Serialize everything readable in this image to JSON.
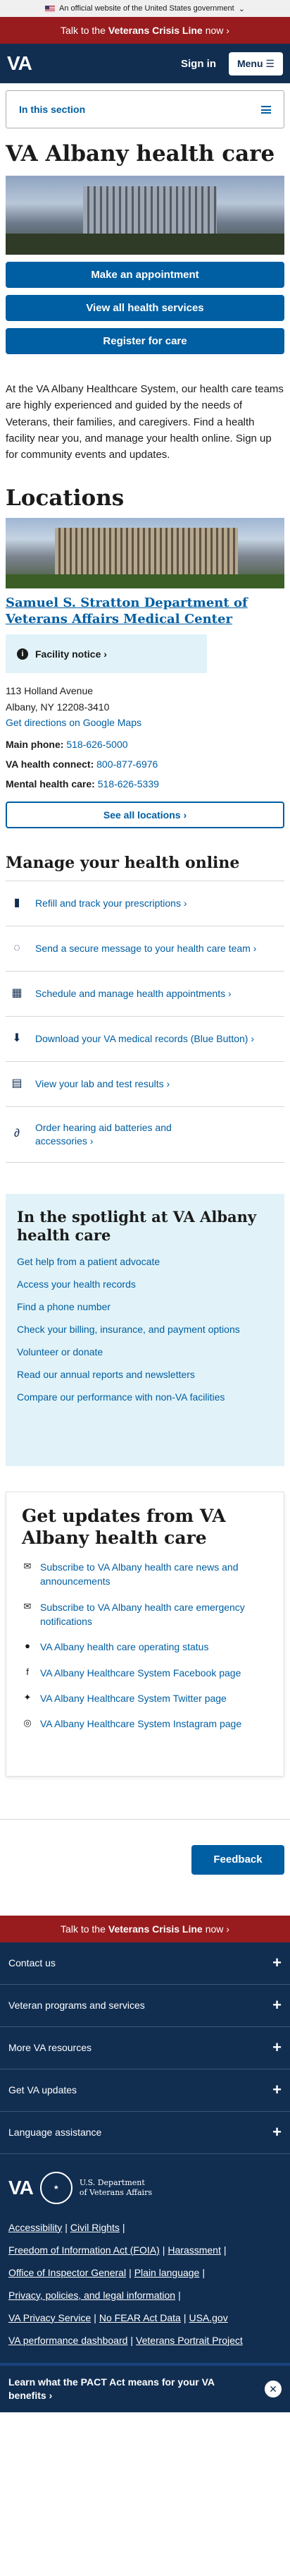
{
  "gov_banner": {
    "text": "An official website of the United States government",
    "chevron": "chevron-down-icon"
  },
  "crisis": {
    "prefix": "Talk to the",
    "strong": "Veterans Crisis Line",
    "suffix": "now ›"
  },
  "header": {
    "logo": "VA",
    "signin": "Sign in",
    "menu": "Menu"
  },
  "section_nav": {
    "label": "In this section"
  },
  "page": {
    "title": "VA Albany health care",
    "buttons": [
      "Make an appointment",
      "View all health services",
      "Register for care"
    ],
    "intro": "At the VA Albany Healthcare System, our health care teams are highly experienced and guided by the needs of Veterans, their families, and caregivers. Find a health facility near you, and manage your health online. Sign up for community events and updates."
  },
  "locations": {
    "heading": "Locations",
    "facility_name": "Samuel S. Stratton Department of Veterans Affairs Medical Center",
    "notice": "Facility notice ›",
    "address_line1": "113 Holland Avenue",
    "address_line2": "Albany, NY 12208-3410",
    "directions": "Get directions on Google Maps",
    "main_phone_label": "Main phone:",
    "main_phone": "518-626-5000",
    "va_connect_label": "VA health connect:",
    "va_connect": "800-877-6976",
    "mental_label": "Mental health care:",
    "mental": "518-626-5339",
    "see_all": "See all locations ›"
  },
  "manage": {
    "heading": "Manage your health online",
    "items": [
      {
        "label": "Refill and track your prescriptions ›",
        "icon": "pill-bottle-icon"
      },
      {
        "label": "Send a secure message to your health care team ›",
        "icon": "chat-bubble-icon"
      },
      {
        "label": "Schedule and manage health appointments ›",
        "icon": "calendar-icon"
      },
      {
        "label": "Download your VA medical records (Blue Button) ›",
        "icon": "download-icon"
      },
      {
        "label": "View your lab and test results ›",
        "icon": "clipboard-icon"
      },
      {
        "label": "Order hearing aid batteries and accessories ›",
        "icon": "hearing-aid-icon"
      }
    ]
  },
  "spotlight": {
    "heading": "In the spotlight at VA Albany health care",
    "links": [
      "Get help from a patient advocate",
      "Access your health records",
      "Find a phone number",
      "Check your billing, insurance, and payment options",
      "Volunteer or donate",
      "Read our annual reports and newsletters",
      "Compare our performance with non-VA facilities"
    ]
  },
  "updates": {
    "heading": "Get updates from VA Albany health care",
    "items": [
      {
        "label": "Subscribe to VA Albany health care news and announcements",
        "icon": "envelope-icon"
      },
      {
        "label": "Subscribe to VA Albany health care emergency notifications",
        "icon": "envelope-icon"
      },
      {
        "label": "VA Albany health care operating status",
        "icon": "alert-circle-icon"
      },
      {
        "label": "VA Albany Healthcare System Facebook page",
        "icon": "facebook-icon"
      },
      {
        "label": "VA Albany Healthcare System Twitter page",
        "icon": "twitter-icon"
      },
      {
        "label": "VA Albany Healthcare System Instagram page",
        "icon": "instagram-icon"
      }
    ]
  },
  "feedback": "Feedback",
  "footer": {
    "accordion": [
      "Contact us",
      "Veteran programs and services",
      "More VA resources",
      "Get VA updates",
      "Language assistance"
    ],
    "logo": "VA",
    "dept_line1": "U.S. Department",
    "dept_line2": "of Veterans Affairs",
    "links": [
      [
        "Accessibility",
        "Civil Rights"
      ],
      [
        "Freedom of Information Act (FOIA)",
        "Harassment"
      ],
      [
        "Office of Inspector General",
        "Plain language"
      ],
      [
        "Privacy, policies, and legal information"
      ],
      [
        "VA Privacy Service",
        "No FEAR Act Data",
        "USA.gov"
      ],
      [
        "VA performance dashboard",
        "Veterans Portrait Project"
      ]
    ],
    "pact": "Learn what the PACT Act means for your VA benefits ›"
  },
  "colors": {
    "primary": "#005ea2",
    "navy": "#112e51",
    "crisis": "#981b1e",
    "spotlight_bg": "#e1f3f8"
  }
}
